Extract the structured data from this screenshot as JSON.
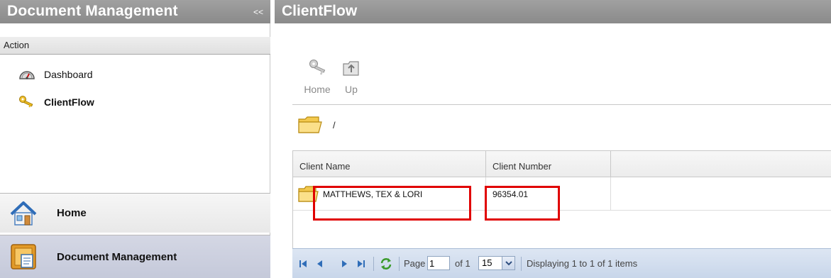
{
  "left_panel": {
    "title": "Document Management",
    "collapse_label": "<<",
    "action_label": "Action",
    "items": [
      {
        "label": "Dashboard",
        "icon": "dashboard-gauge-icon"
      },
      {
        "label": "ClientFlow",
        "icon": "keys-icon"
      }
    ],
    "bottom_buttons": [
      {
        "label": "Home",
        "icon": "home-icon"
      },
      {
        "label": "Document Management",
        "icon": "document-management-icon"
      }
    ]
  },
  "right_panel": {
    "title": "ClientFlow",
    "toolbar": {
      "home_label": "Home",
      "up_label": "Up"
    },
    "path": "/",
    "grid": {
      "columns": [
        "Client Name",
        "Client Number"
      ],
      "rows": [
        {
          "name": "MATTHEWS, TEX & LORI",
          "number": "96354.01"
        }
      ]
    },
    "pager": {
      "page_label": "Page",
      "page_value": "1",
      "of_label": "of 1",
      "page_size": "15",
      "display_text": "Displaying 1 to 1 of 1 items"
    }
  },
  "colors": {
    "header_gray": "#9a9a9a",
    "highlight_red": "#e00000",
    "pager_blue": "#d3dff0"
  }
}
